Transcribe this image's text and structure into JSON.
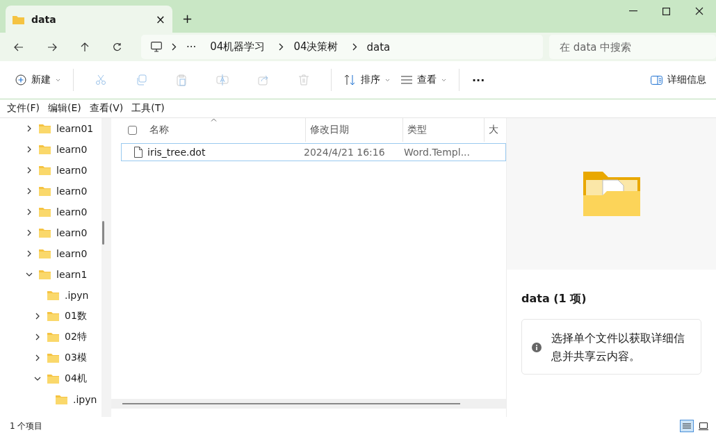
{
  "tab": {
    "title": "data",
    "close": "×",
    "new": "+"
  },
  "breadcrumb": {
    "more": "···",
    "items": [
      "04机器学习",
      "04决策树",
      "data"
    ]
  },
  "search": {
    "placeholder": "在 data 中搜索"
  },
  "toolbar": {
    "new": "新建",
    "sort": "排序",
    "view": "查看",
    "more": "···",
    "details": "详细信息"
  },
  "menu": [
    "文件(F)",
    "编辑(E)",
    "查看(V)",
    "工具(T)"
  ],
  "tree": [
    {
      "label": "learn01",
      "expandable": true,
      "expanded": false
    },
    {
      "label": "learn0",
      "expandable": true,
      "expanded": false
    },
    {
      "label": "learn0",
      "expandable": true,
      "expanded": false
    },
    {
      "label": "learn0",
      "expandable": true,
      "expanded": false
    },
    {
      "label": "learn0",
      "expandable": true,
      "expanded": false
    },
    {
      "label": "learn0",
      "expandable": true,
      "expanded": false
    },
    {
      "label": "learn0",
      "expandable": true,
      "expanded": false
    },
    {
      "label": "learn1",
      "expandable": true,
      "expanded": true,
      "children": [
        {
          "label": ".ipyn",
          "expandable": false,
          "expanded": false
        },
        {
          "label": "01数",
          "expandable": true,
          "expanded": false
        },
        {
          "label": "02特",
          "expandable": true,
          "expanded": false
        },
        {
          "label": "03模",
          "expandable": true,
          "expanded": false
        },
        {
          "label": "04机",
          "expandable": true,
          "expanded": true,
          "children": [
            {
              "label": ".ipyn",
              "expandable": false,
              "expanded": false
            }
          ]
        }
      ]
    }
  ],
  "table": {
    "select_all": {
      "checked": false
    },
    "columns": [
      "名称",
      "修改日期",
      "类型",
      "大"
    ],
    "rows": [
      {
        "name": "iris_tree.dot",
        "modified": "2024/4/21 16:16",
        "type": "Word.Templ...",
        "selected": true
      }
    ]
  },
  "details": {
    "title": "data (1 项)",
    "message": "选择单个文件以获取详细信息并共享云内容。"
  },
  "status_bar": {
    "count": "1 个项目"
  }
}
